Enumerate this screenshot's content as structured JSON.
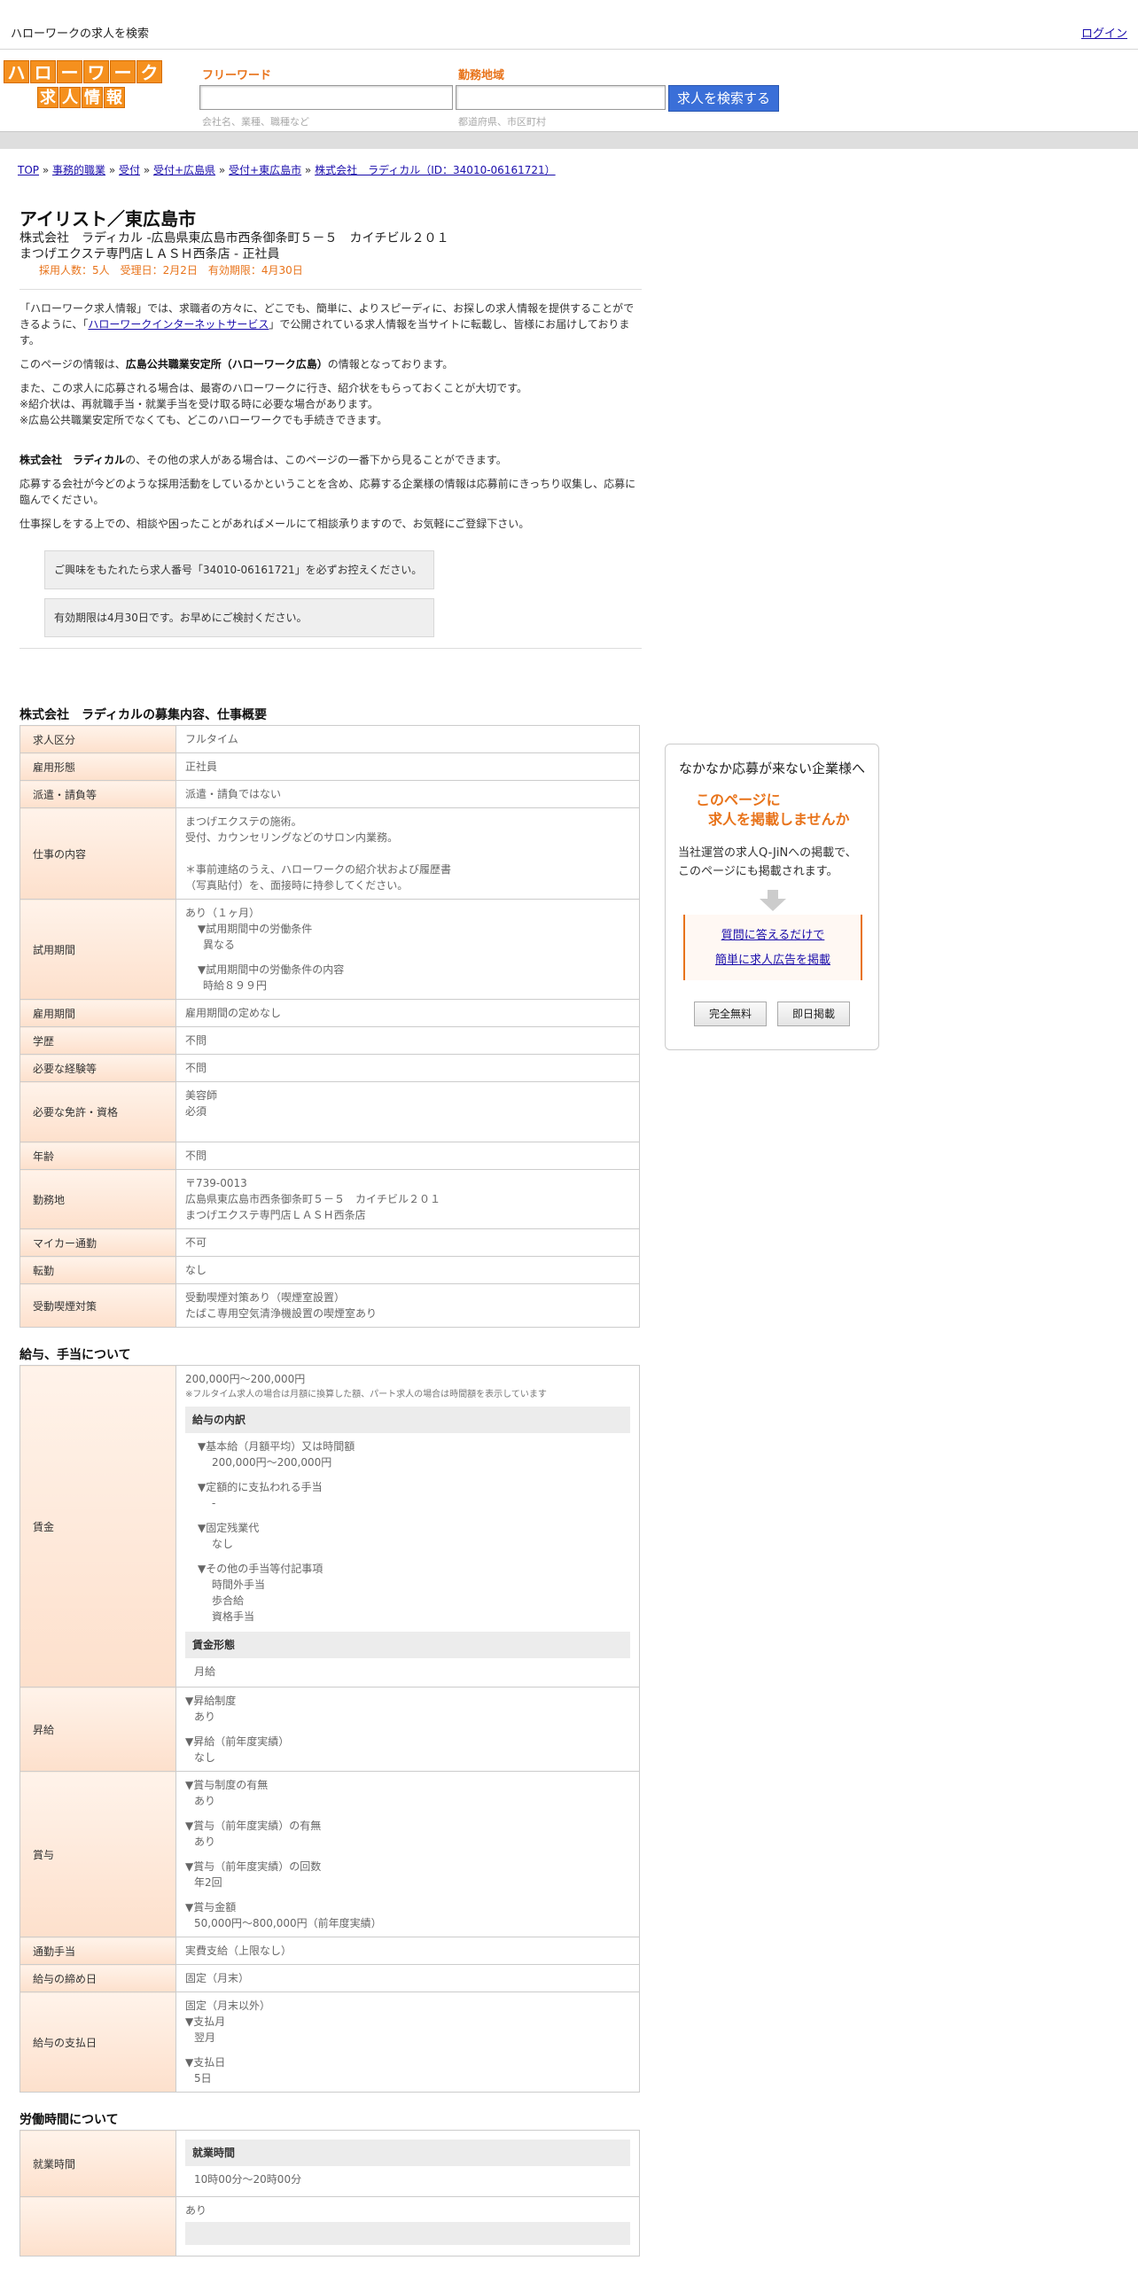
{
  "topbar": {
    "title": "ハローワークの求人を検索",
    "login": "ログイン"
  },
  "logo": {
    "row1": [
      "ハ",
      "ロ",
      "ー",
      "ワ",
      "ー",
      "ク"
    ],
    "row2": [
      "求",
      "人",
      "情",
      "報"
    ]
  },
  "search": {
    "freeword_label": "フリーワード",
    "freeword_hint": "会社名、業種、職種など",
    "area_label": "勤務地域",
    "area_hint": "都道府県、市区町村",
    "button": "求人を検索する"
  },
  "breadcrumb": {
    "items": [
      "TOP",
      "事務的職業",
      "受付",
      "受付+広島県",
      "受付+東広島市",
      "株式会社　ラディカル（ID：34010-06161721）"
    ],
    "sep": " » "
  },
  "job": {
    "title": "アイリスト／東広島市",
    "company_line": "株式会社　ラディカル -広島県東広島市西条御条町５－５　カイチビル２０１",
    "store_line": "まつげエクステ専門店ＬＡＳＨ西条店 - 正社員",
    "meta": "採用人数：5人　受理日：2月2日　有効期限：4月30日"
  },
  "intro": {
    "p1_a": "「ハローワーク求人情報」では、求職者の方々に、どこでも、簡単に、よりスピーディに、お探しの求人情報を提供することができるように、「",
    "p1_link": "ハローワークインターネットサービス",
    "p1_b": "」で公開されている求人情報を当サイトに転載し、皆様にお届けしております。",
    "p2_a": "このページの情報は、",
    "p2_b": "広島公共職業安定所（ハローワーク広島）",
    "p2_c": "の情報となっております。",
    "p3_1": "また、この求人に応募される場合は、最寄のハローワークに行き、紹介状をもらっておくことが大切です。",
    "p3_2": "※紹介状は、再就職手当・就業手当を受け取る時に必要な場合があります。",
    "p3_3": "※広島公共職業安定所でなくても、どこのハローワークでも手続きできます。",
    "p4_a": "株式会社　ラディカル",
    "p4_b": "の、その他の求人がある場合は、このページの一番下から見ることができます。",
    "p5": "応募する会社が今どのような採用活動をしているかということを含め、応募する企業様の情報は応募前にきっちり収集し、応募に臨んでください。",
    "p6": "仕事探しをする上での、相談や困ったことがあればメールにて相談承りますので、お気軽にご登録下さい。",
    "box1": "ご興味をもたれたら求人番号「34010-06161721」を必ずお控えください。",
    "box2": "有効期限は4月30日です。お早めにご検討ください。"
  },
  "overview": {
    "title": "株式会社　ラディカルの募集内容、仕事概要",
    "rows": {
      "kubun": {
        "label": "求人区分",
        "value": "フルタイム"
      },
      "keitai": {
        "label": "雇用形態",
        "value": "正社員"
      },
      "haken": {
        "label": "派遣・請負等",
        "value": "派遣・請負ではない"
      },
      "naiyo": {
        "label": "仕事の内容",
        "l1": "まつげエクステの施術。",
        "l2": "受付、カウンセリングなどのサロン内業務。",
        "l3": "＊事前連絡のうえ、ハローワークの紹介状および履歴書",
        "l4": "（写真貼付）を、面接時に持参してください。"
      },
      "shiyo": {
        "label": "試用期間",
        "l1": "あり（１ヶ月）",
        "l2": "▼試用期間中の労働条件",
        "l3": "異なる",
        "l4": "▼試用期間中の労働条件の内容",
        "l5": "時給８９９円"
      },
      "kikan": {
        "label": "雇用期間",
        "value": "雇用期間の定めなし"
      },
      "gakureki": {
        "label": "学歴",
        "value": "不問"
      },
      "keiken": {
        "label": "必要な経験等",
        "value": "不問"
      },
      "menkyo": {
        "label": "必要な免許・資格",
        "l1": "美容師",
        "l2": "必須"
      },
      "nenrei": {
        "label": "年齢",
        "value": "不問"
      },
      "kinmuchi": {
        "label": "勤務地",
        "l1": "〒739-0013",
        "l2": "広島県東広島市西条御条町５－５　カイチビル２０１",
        "l3": "まつげエクステ専門店ＬＡＳＨ西条店"
      },
      "maika": {
        "label": "マイカー通勤",
        "value": "不可"
      },
      "tenkin": {
        "label": "転勤",
        "value": "なし"
      },
      "kitsuen": {
        "label": "受動喫煙対策",
        "l1": "受動喫煙対策あり（喫煙室設置）",
        "l2": "たばこ専用空気清浄機設置の喫煙室あり"
      }
    }
  },
  "salary": {
    "title": "給与、手当について",
    "chingin": {
      "label": "賃金",
      "range": "200,000円〜200,000円",
      "note": "※フルタイム求人の場合は月額に換算した額、パート求人の場合は時間額を表示しています",
      "breakdown_head": "給与の内訳",
      "kihon_h": "▼基本給（月額平均）又は時間額",
      "kihon_v": "200,000円〜200,000円",
      "teigaku_h": "▼定額的に支払われる手当",
      "teigaku_v": "-",
      "kotei_h": "▼固定残業代",
      "kotei_v": "なし",
      "sonota_h": "▼その他の手当等付記事項",
      "sonota_1": "時間外手当",
      "sonota_2": "歩合給",
      "sonota_3": "資格手当",
      "form_head": "賃金形態",
      "form_v": "月給"
    },
    "shokyu": {
      "label": "昇給",
      "h1": "▼昇給制度",
      "v1": "あり",
      "h2": "▼昇給（前年度実績）",
      "v2": "なし"
    },
    "shoyo": {
      "label": "賞与",
      "h1": "▼賞与制度の有無",
      "v1": "あり",
      "h2": "▼賞与（前年度実績）の有無",
      "v2": "あり",
      "h3": "▼賞与（前年度実績）の回数",
      "v3": "年2回",
      "h4": "▼賞与金額",
      "v4": "50,000円〜800,000円（前年度実績）"
    },
    "tsukin": {
      "label": "通勤手当",
      "value": "実費支給（上限なし）"
    },
    "shimebi": {
      "label": "給与の締め日",
      "value": "固定（月末）"
    },
    "shiharai": {
      "label": "給与の支払日",
      "l1": "固定（月末以外）",
      "h1": "▼支払月",
      "v1": "翌月",
      "h2": "▼支払日",
      "v2": "5日"
    }
  },
  "hours": {
    "title": "労働時間について",
    "shugyo": {
      "label": "就業時間",
      "head": "就業時間",
      "value": "10時00分〜20時00分"
    },
    "next_value": "あり"
  },
  "ad": {
    "title": "なかなか応募が来ない企業様へ",
    "catch1": "このページに",
    "catch2": "求人を掲載しませんか",
    "text1": "当社運営の求人Q-JiNへの掲載で、",
    "text2": "このページにも掲載されます。",
    "link1": "質問に答えるだけで",
    "link2": "簡単に求人広告を掲載",
    "btn1": "完全無料",
    "btn2": "即日掲載"
  }
}
